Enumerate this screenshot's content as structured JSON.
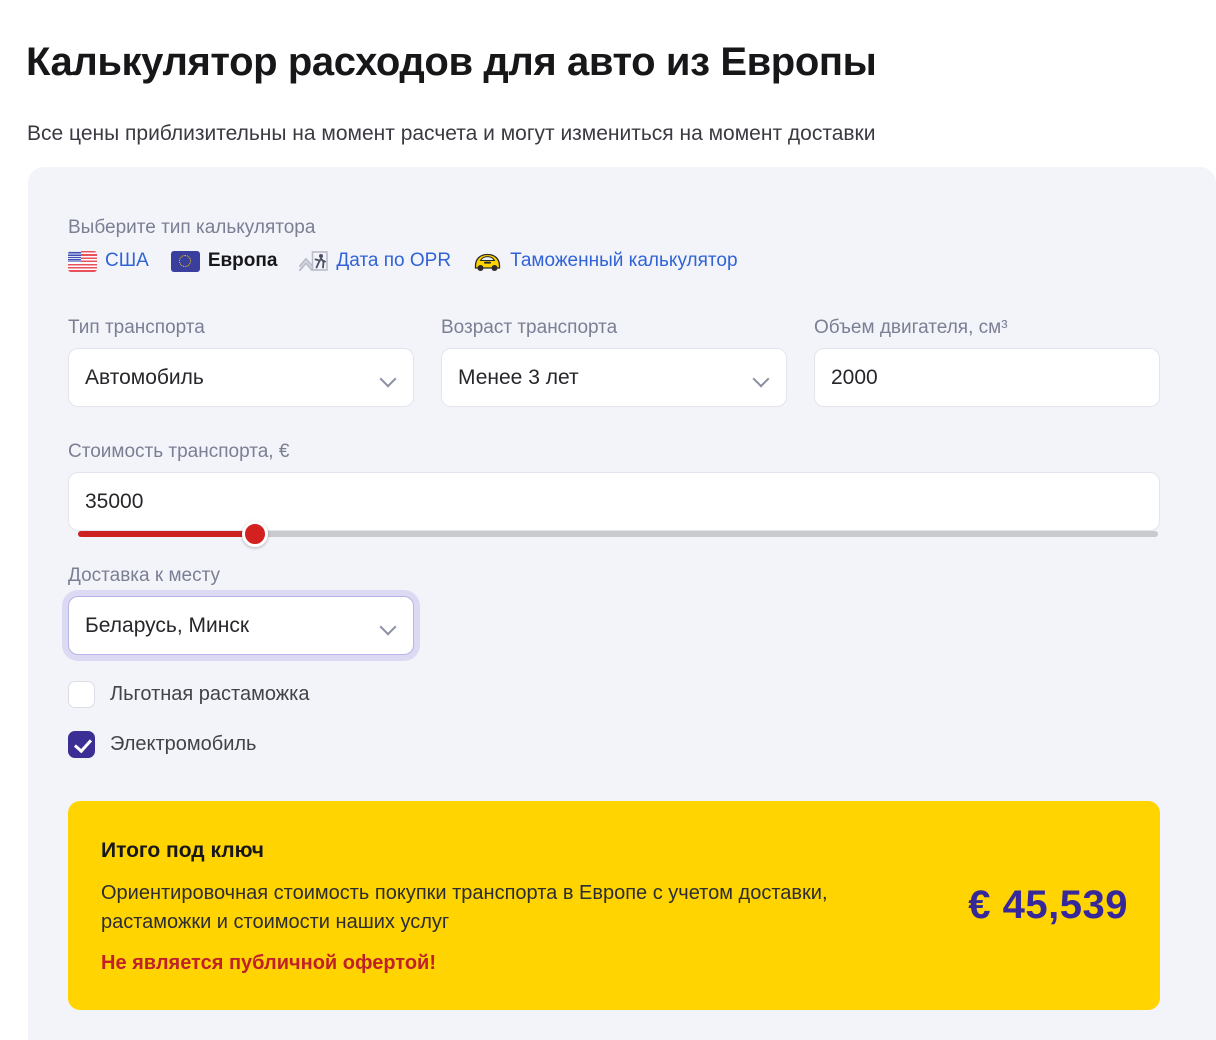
{
  "header": {
    "title": "Калькулятор расходов для авто из Европы",
    "subtitle": "Все цены приблизительны на момент расчета и могут измениться на момент доставки"
  },
  "calculator_type": {
    "label": "Выберите тип калькулятора",
    "tabs": [
      {
        "label": "США",
        "icon": "flag-usa-icon",
        "active": false
      },
      {
        "label": "Европа",
        "icon": "flag-eu-icon",
        "active": true
      },
      {
        "label": "Дата по OPR",
        "icon": "runner-track-icon",
        "active": false
      },
      {
        "label": "Таможенный калькулятор",
        "icon": "yellow-car-icon",
        "active": false
      }
    ]
  },
  "fields": {
    "vehicle_type": {
      "label": "Тип транспорта",
      "value": "Автомобиль",
      "control": "select"
    },
    "vehicle_age": {
      "label": "Возраст транспорта",
      "value": "Менее 3 лет",
      "control": "select"
    },
    "engine_volume": {
      "label": "Объем двигателя, см³",
      "value": "2000",
      "control": "input"
    },
    "price": {
      "label": "Стоимость транспорта, €",
      "value": "35000",
      "control": "input",
      "slider_percent": 16.4
    },
    "delivery": {
      "label": "Доставка к месту",
      "value": "Беларусь, Минск",
      "control": "select",
      "focused": true
    }
  },
  "checkboxes": [
    {
      "label": "Льготная растаможка",
      "checked": false
    },
    {
      "label": "Электромобиль",
      "checked": true
    }
  ],
  "result": {
    "heading": "Итого под ключ",
    "description": "Ориентировочная стоимость покупки транспорта в Европе с учетом доставки, растаможки и стоимости наших услуг",
    "note": "Не является публичной офертой!",
    "amount": "€ 45,539"
  },
  "colors": {
    "page_bg": "#ffffff",
    "card_bg": "#f3f4fa",
    "link": "#3063d5",
    "accent_yellow": "#ffd400",
    "accent_indigo": "#36289a",
    "accent_red": "#c0202a",
    "slider_fill": "#cc2222",
    "checkbox_checked": "#3b2f96"
  }
}
